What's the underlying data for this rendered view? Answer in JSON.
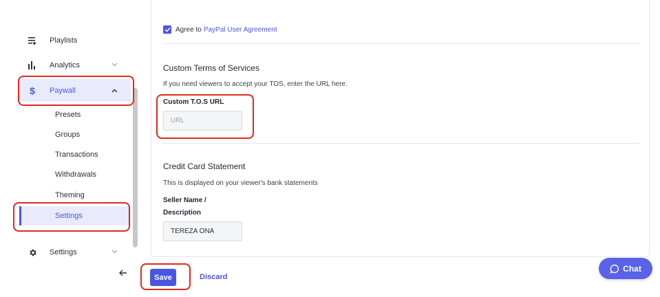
{
  "sidebar": {
    "items": [
      {
        "label": "Playlists",
        "icon": "playlist-icon"
      },
      {
        "label": "Analytics",
        "icon": "analytics-icon"
      },
      {
        "label": "Paywall",
        "icon": "dollar-icon",
        "expanded": true
      },
      {
        "label": "Settings",
        "icon": "gear-icon"
      }
    ],
    "paywall_subitems": [
      {
        "label": "Presets"
      },
      {
        "label": "Groups"
      },
      {
        "label": "Transactions"
      },
      {
        "label": "Withdrawals"
      },
      {
        "label": "Theming"
      },
      {
        "label": "Settings",
        "selected": true
      }
    ]
  },
  "agreement": {
    "prefix": "Agree to",
    "link": "PayPal User Agreement",
    "checked": true
  },
  "tos": {
    "title": "Custom Terms of Services",
    "description": "If you need viewers to accept your TOS, enter the URL here.",
    "field_label": "Custom T.O.S URL",
    "placeholder": "URL",
    "value": ""
  },
  "statement": {
    "title": "Credit Card Statement",
    "description": "This is displayed on your viewer's bank statements",
    "field_label_line1": "Seller Name /",
    "field_label_line2": "Description",
    "value": "TEREZA ONĂ"
  },
  "actions": {
    "save_label": "Save",
    "discard_label": "Discard"
  },
  "chat": {
    "label": "Chat"
  },
  "colors": {
    "accent": "#4a56e2",
    "highlight": "#e0281c",
    "active_bg": "#e9ebfc"
  }
}
